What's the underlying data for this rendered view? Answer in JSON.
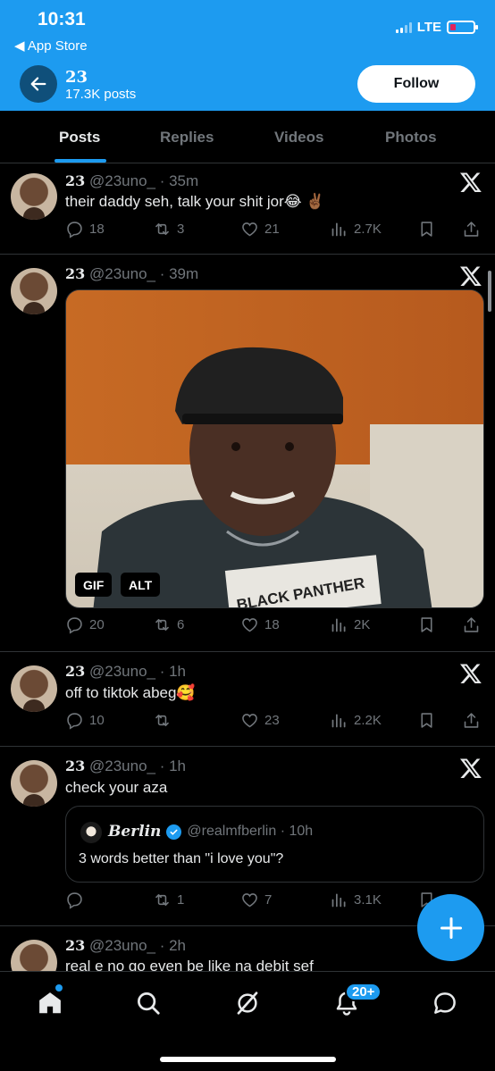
{
  "status_bar": {
    "time": "10:31",
    "back_app": "◀ App Store",
    "network": "LTE"
  },
  "header": {
    "name": "23",
    "post_count": "17.3K posts",
    "follow_label": "Follow",
    "accent_color": "#1d9bf0"
  },
  "tabs": [
    {
      "label": "Posts",
      "active": true
    },
    {
      "label": "Replies",
      "active": false
    },
    {
      "label": "Videos",
      "active": false
    },
    {
      "label": "Photos",
      "active": false
    }
  ],
  "posts": [
    {
      "name": "23",
      "handle_time": "@23uno_ · 35m",
      "text": "their daddy seh, talk your shit jor😂 ✌🏾",
      "replies": "18",
      "reposts": "3",
      "likes": "21",
      "views": "2.7K"
    },
    {
      "name": "23",
      "handle_time": "@23uno_ · 39m",
      "media_badges": [
        "GIF",
        "ALT"
      ],
      "media_shirt_text": "BLACK PANTHER",
      "replies": "20",
      "reposts": "6",
      "likes": "18",
      "views": "2K"
    },
    {
      "name": "23",
      "handle_time": "@23uno_ · 1h",
      "text": "off to tiktok abeg🥰",
      "replies": "10",
      "reposts": "",
      "likes": "23",
      "views": "2.2K"
    },
    {
      "name": "23",
      "handle_time": "@23uno_ · 1h",
      "text": "check your aza",
      "quote": {
        "name": "Berlin",
        "handle_time": "@realmfberlin · 10h",
        "text": "3 words better than \"i love you\"?"
      },
      "replies": "",
      "reposts": "1",
      "likes": "7",
      "views": "3.1K"
    },
    {
      "name": "23",
      "handle_time": "@23uno_ · 2h",
      "text": "real e no go even be like na debit sef"
    }
  ],
  "bottom_nav": {
    "notifications_badge": "20+"
  }
}
